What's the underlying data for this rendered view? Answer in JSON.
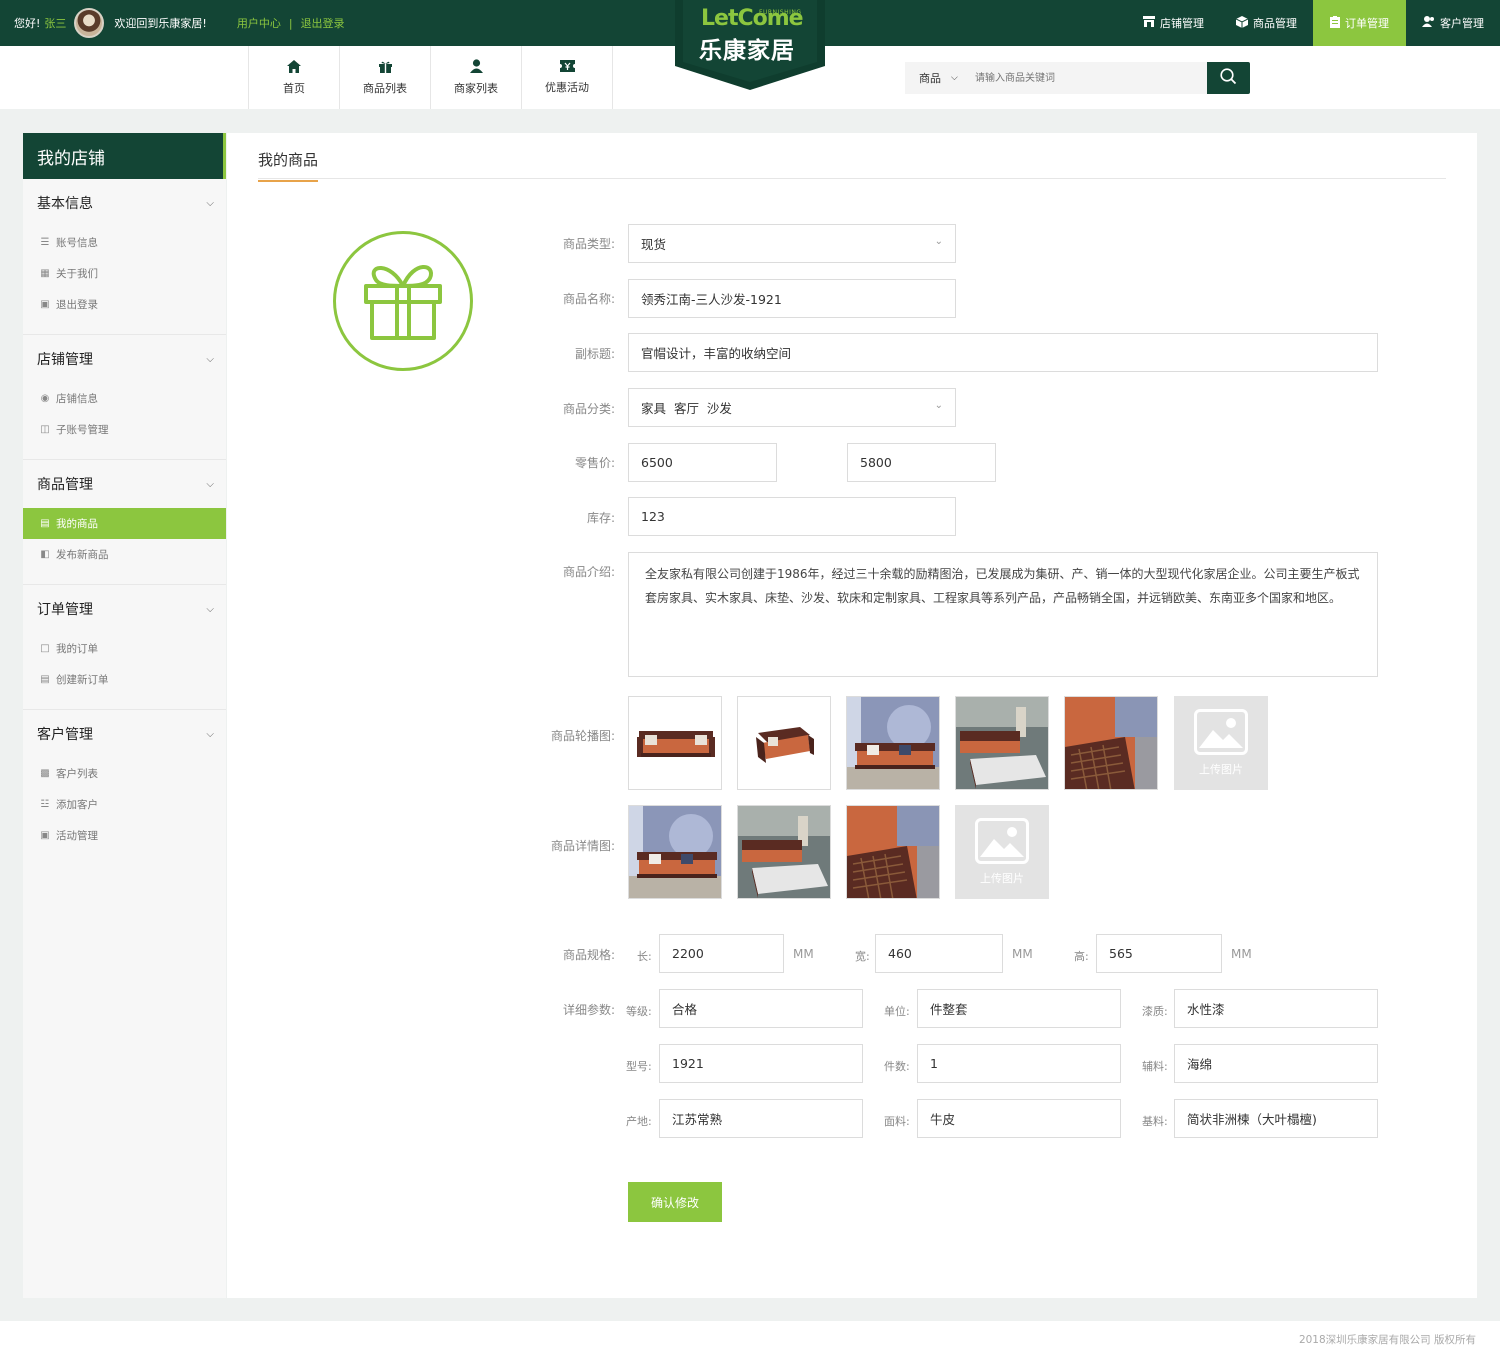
{
  "topbar": {
    "greeting": "您好!",
    "user_name": "张三",
    "welcome": "欢迎回到乐康家居!",
    "user_center": "用户中心",
    "separator": "|",
    "logout": "退出登录",
    "right_menu": [
      {
        "label": "店铺管理",
        "icon": "store-icon"
      },
      {
        "label": "商品管理",
        "icon": "box-icon"
      },
      {
        "label": "订单管理",
        "icon": "clipboard-icon"
      },
      {
        "label": "客户管理",
        "icon": "users-icon"
      }
    ],
    "active_menu": "订单管理"
  },
  "logo": {
    "en": "LetCome",
    "tagline": "FURNISHING",
    "cn": "乐康家居"
  },
  "nav": [
    {
      "label": "首页",
      "icon": "home-icon"
    },
    {
      "label": "商品列表",
      "icon": "gift-icon"
    },
    {
      "label": "商家列表",
      "icon": "user-icon"
    },
    {
      "label": "优惠活动",
      "icon": "coupon-icon"
    }
  ],
  "search": {
    "category": "商品",
    "placeholder": "请输入商品关键词"
  },
  "sidebar": {
    "title": "我的店铺",
    "groups": [
      {
        "title": "基本信息",
        "items": [
          {
            "label": "账号信息",
            "icon": "list-icon"
          },
          {
            "label": "关于我们",
            "icon": "grid-icon"
          },
          {
            "label": "退出登录",
            "icon": "logout-icon"
          }
        ]
      },
      {
        "title": "店铺管理",
        "items": [
          {
            "label": "店铺信息",
            "icon": "eye-icon"
          },
          {
            "label": "子账号管理",
            "icon": "monitor-icon"
          }
        ]
      },
      {
        "title": "商品管理",
        "items": [
          {
            "label": "我的商品",
            "icon": "product-icon",
            "active": true
          },
          {
            "label": "发布新商品",
            "icon": "folder-icon"
          }
        ]
      },
      {
        "title": "订单管理",
        "items": [
          {
            "label": "我的订单",
            "icon": "chat-icon"
          },
          {
            "label": "创建新订单",
            "icon": "document-icon"
          }
        ]
      },
      {
        "title": "客户管理",
        "items": [
          {
            "label": "客户列表",
            "icon": "card-icon"
          },
          {
            "label": "添加客户",
            "icon": "bank-icon"
          },
          {
            "label": "活动管理",
            "icon": "gift-icon"
          }
        ]
      }
    ]
  },
  "main": {
    "title": "我的商品",
    "form": {
      "type_label": "商品类型:",
      "type_value": "现货",
      "name_label": "商品名称:",
      "name_value": "领秀江南-三人沙发-1921",
      "subtitle_label": "副标题:",
      "subtitle_value": "官帽设计，丰富的收纳空间",
      "category_label": "商品分类:",
      "category_value": "家具  客厅  沙发",
      "price_label": "零售价:",
      "price_value": "6500",
      "price_value2": "5800",
      "stock_label": "库存:",
      "stock_value": "123",
      "intro_label": "商品介绍:",
      "intro_value": "全友家私有限公司创建于1986年，经过三十余载的励精图治，已发展成为集研、产、销一体的大型现代化家居企业。公司主要生产板式套房家具、实木家具、床垫、沙发、软床和定制家具、工程家具等系列产品，产品畅销全国，并远销欧美、东南亚多个国家和地区。",
      "carousel_label": "商品轮播图:",
      "detail_label": "商品详情图:",
      "upload_text": "上传图片",
      "spec_label": "商品规格:",
      "spec": {
        "length_label": "长:",
        "length_value": "2200",
        "width_label": "宽:",
        "width_value": "460",
        "height_label": "高:",
        "height_value": "565",
        "unit": "MM"
      },
      "params_label": "详细参数:",
      "params": [
        {
          "label": "等级:",
          "value": "合格"
        },
        {
          "label": "单位:",
          "value": "件整套"
        },
        {
          "label": "漆质:",
          "value": "水性漆"
        },
        {
          "label": "型号:",
          "value": "1921"
        },
        {
          "label": "件数:",
          "value": "1"
        },
        {
          "label": "辅料:",
          "value": "海绵"
        },
        {
          "label": "产地:",
          "value": "江苏常熟"
        },
        {
          "label": "面料:",
          "value": "牛皮"
        },
        {
          "label": "基料:",
          "value": "简状非洲楝（大叶榻檀)"
        }
      ],
      "confirm_label": "确认修改"
    }
  },
  "footer": {
    "copyright": "2018深圳乐康家居有限公司  版权所有"
  },
  "colors": {
    "primary_dark": "#134535",
    "accent_green": "#8cc63f",
    "accent_orange": "#e8a34a"
  }
}
